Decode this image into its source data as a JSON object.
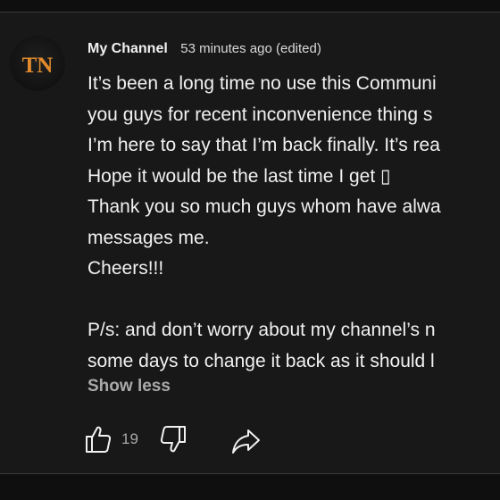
{
  "post": {
    "channel_name": "My Channel",
    "time": "53 minutes ago (edited)",
    "avatar_initials": "TN",
    "lines": [
      "It’s been a long time no use this Communi",
      "you guys for recent inconvenience thing s",
      "I’m here to say that I’m back finally. It’s rea",
      "Hope it would be the last time I get ▯",
      "Thank you so much guys whom have alwa",
      "messages me.",
      "Cheers!!!",
      "",
      "P/s: and don’t worry about my channel’s n",
      "some days to change it back as it should l"
    ],
    "show_less_label": "Show less",
    "like_count": "19"
  },
  "icons": {
    "like": "thumbs-up-icon",
    "dislike": "thumbs-down-icon",
    "share": "share-icon"
  },
  "colors": {
    "background": "#0f0f0f",
    "panel": "#181818",
    "text": "#f1f1f1",
    "muted": "#aaaaaa",
    "avatar_accent": "#e08a2c"
  }
}
